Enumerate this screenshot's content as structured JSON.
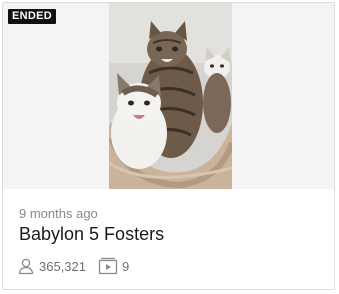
{
  "card": {
    "badge": "ENDED",
    "time_ago": "9 months ago",
    "title": "Babylon 5 Fosters",
    "viewers": "365,321",
    "episodes": "9",
    "image_subject": "kittens-in-cat-bed"
  },
  "icons": {
    "viewers": "person-icon",
    "episodes": "video-play-icon"
  }
}
